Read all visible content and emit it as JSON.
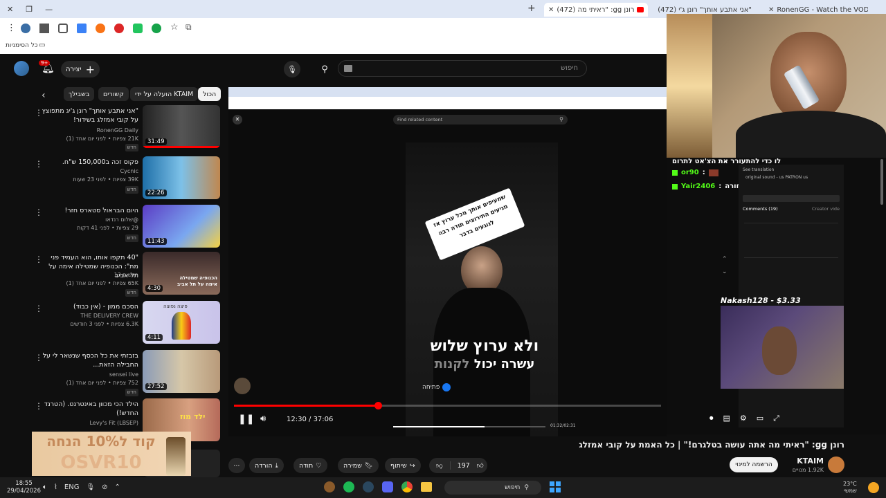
{
  "tabs": [
    {
      "label": "רונן gg: \"ראיתי מה (472)",
      "active": true
    },
    {
      "label": "\"אני אתבע אותך\" רונן ג'י (472)",
      "active": false
    },
    {
      "label": "RonenGG - Watch the VOD on",
      "active": false
    }
  ],
  "bookmarks_label": "כל הסימניות",
  "youtube": {
    "create_label": "יצירה",
    "notif_count": "9+",
    "search_placeholder": "חיפוש"
  },
  "chips": [
    "הכול",
    "הועלה על ידי KTAIM",
    "קשורים",
    "בשבילך"
  ],
  "recs": [
    {
      "title": "\"אני אתבע אותך\" רונן ג'יג מתפוצץ על קובי אמזלג בשידור!",
      "channel": "RonenGG Daily",
      "stats": "21K צפיות • לפני יום אחד (1)",
      "badge": "חדש",
      "duration": "31:49"
    },
    {
      "title": "פקוס זכה ב150,000 ש\"ח.",
      "channel": "Cycnic",
      "stats": "39K צפיות • לפני 23 שעות",
      "badge": "חדש",
      "duration": "22:26"
    },
    {
      "title": "היום הבראול סטארס חזר!",
      "channel": "@שלום רנדאו",
      "stats": "29 צפיות • לפני 41 דקות",
      "badge": "חדש",
      "duration": "11:43"
    },
    {
      "title": "\"40 תקפו אותו, הוא העמיד פני מת\": הכנופיה שמטילה אימה על תל אביב",
      "channel": "חדשות 13",
      "stats": "65K צפיות • לפני יום אחד (1)",
      "badge": "חדש",
      "duration": "4:30"
    },
    {
      "title": "הסכם ממון - (אין כבוד)",
      "channel": "THE DELIVERY CREW",
      "stats": "6.3K צפיות • לפני 3 חודשים",
      "badge": "",
      "duration": "4:11"
    },
    {
      "title": "בזבזתי את כל הכסף שנשאר לי על החבילה הזאת...",
      "channel": "sensei live",
      "stats": "752 צפיות • לפני יום אחד (1)",
      "badge": "חדש",
      "duration": "27:52"
    },
    {
      "title": "הילד הכי מכוון באינטרנט. (הטרנד החדש!)",
      "channel": "Levy's Fit (LBSEP)",
      "stats": "",
      "badge": "",
      "duration": ""
    }
  ],
  "thumb_texts": {
    "t4": "הכנופיה שמטילה אימה על תל אביב",
    "t5": "פיצה נפוצה",
    "t7": "ילד מוז"
  },
  "video": {
    "inner_search": "Find related content",
    "sticker_text": "שמעיפים אותך מכל ערוץ אז מגיעים התירוצים תודה רבה לנוגעים בדבר",
    "caption_line1": "ולא ערוץ שלוש",
    "caption_line2_a": "עשרה יכול ",
    "caption_line2_b": "לקנות",
    "open_label": "פתיחה",
    "time_current": "12:30",
    "time_total": "37:06",
    "inner_time": "01:32/02:31",
    "progress": 0.337
  },
  "overlay": {
    "chat_header": "לו כדי להתעורר את הצ'אט לתרום",
    "chat1_user": "or90",
    "chat2_user": "Yair2406",
    "chat2_text": "תתייר אחורה",
    "donation": "Nakash128 - $3.33",
    "see_translation": "See translation",
    "original_sound": "original sound - us PATRON us",
    "comments_label": "Comments (19)",
    "creator_videos": "Creator vide"
  },
  "below": {
    "title": "רונן gg: \"ראיתי מה אתה עושה בטלגרם!\" | כל האמת על קובי אמזלג",
    "channel": "KTAIM",
    "subs": "1.92K מנויים",
    "subscribe": "הרשמה למינוי",
    "likes": "197",
    "share": "שיתוף",
    "save": "שמירה",
    "thanks": "תודה",
    "download": "הורדה"
  },
  "promo": {
    "line1": "קוד ל10% הנחה",
    "line2": "OSVR10"
  },
  "taskbar": {
    "time": "18:55",
    "date": "29/04/2026",
    "lang": "ENG",
    "search": "חיפוש",
    "weather": "23°C",
    "weather_label": "שמשי"
  }
}
